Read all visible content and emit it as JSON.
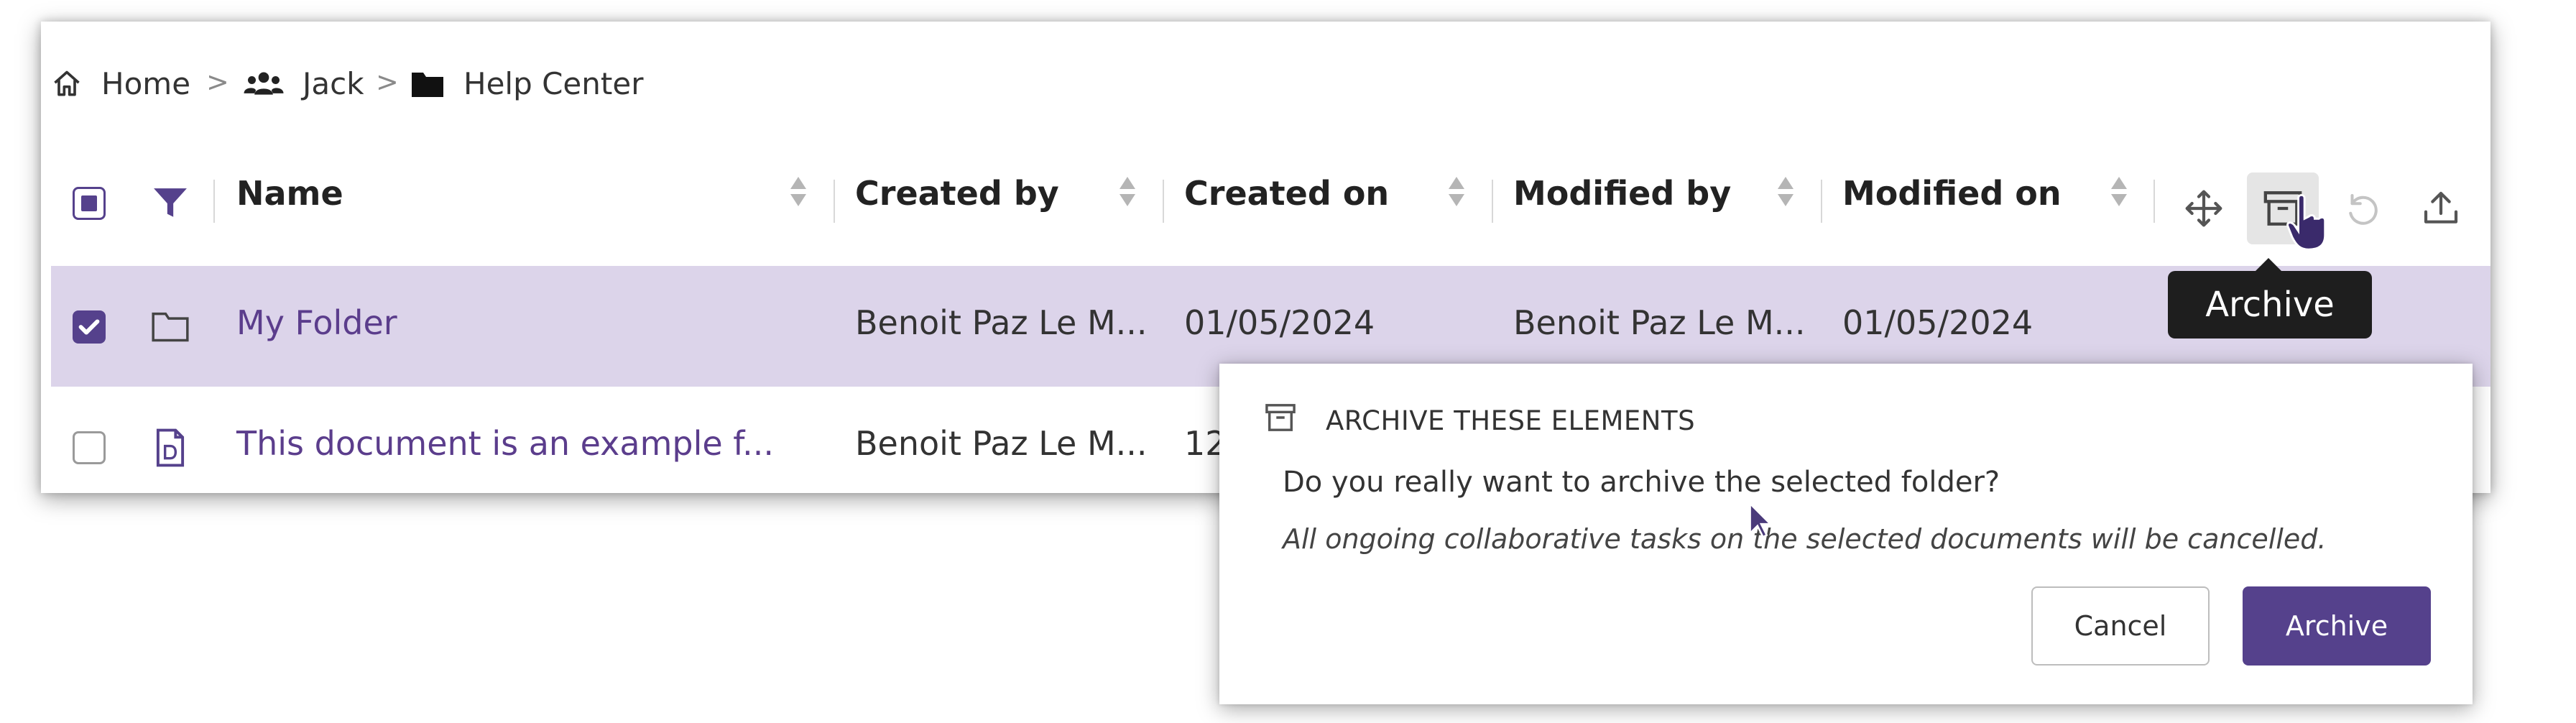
{
  "breadcrumb": {
    "items": [
      {
        "label": "Home",
        "icon": "home-icon"
      },
      {
        "label": "Jack",
        "icon": "group-icon"
      },
      {
        "label": "Help Center",
        "icon": "folder-icon"
      }
    ],
    "separator": ">"
  },
  "table": {
    "columns": [
      "Name",
      "Created by",
      "Created on",
      "Modified by",
      "Modified on"
    ],
    "rows": [
      {
        "icon": "folder-icon",
        "name": "My Folder",
        "created_by": "Benoit Paz Le M...",
        "created_on": "01/05/2024",
        "modified_by": "Benoit Paz Le M...",
        "modified_on": "01/05/2024",
        "selected": true
      },
      {
        "icon": "document-icon",
        "name": "This document is an example f...",
        "created_by": "Benoit Paz Le M...",
        "created_on": "12",
        "selected": false
      }
    ]
  },
  "toolbar": {
    "icons": [
      "move-icon",
      "archive-icon",
      "undo-icon",
      "upload-icon",
      "delete-icon"
    ]
  },
  "tooltip": {
    "text": "Archive"
  },
  "dialog": {
    "title": "ARCHIVE THESE ELEMENTS",
    "question": "Do you really want to archive the selected folder?",
    "note": "All ongoing collaborative tasks on the selected documents will be cancelled.",
    "cancel_label": "Cancel",
    "confirm_label": "Archive"
  },
  "colors": {
    "accent": "#55418c",
    "selected_row": "#dcd4ea",
    "tooltip_bg": "#1e1e1e"
  }
}
